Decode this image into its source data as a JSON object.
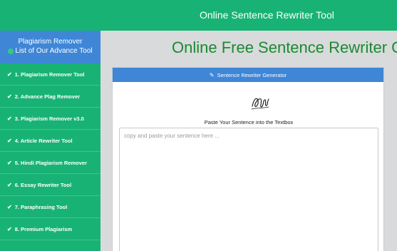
{
  "topbar": {
    "title": "Online Sentence Rewriter Tool"
  },
  "sidebar": {
    "header_line1": "Plagiarism Remover",
    "header_line2": "List of Our Advance Tool",
    "items": [
      {
        "label": "1. Plagiarism Remover Tool"
      },
      {
        "label": "2. Advance Plag Remover"
      },
      {
        "label": "3. Plagiarism Remover v3.0"
      },
      {
        "label": "4. Article Rewriter Tool"
      },
      {
        "label": "5. Hindi Plagiarism Remover"
      },
      {
        "label": "6. Essay Rewriter Tool"
      },
      {
        "label": "7. Paraphrasing Tool"
      },
      {
        "label": "8. Premium Plagiarism"
      }
    ]
  },
  "main": {
    "page_title": "Online Free Sentence Rewriter Gen",
    "panel_title": "Sentence Rewriter Generator",
    "instruction": "Paste Your Sentence into the Textbox",
    "textbox_placeholder": "copy and paste your sentence here ..."
  },
  "colors": {
    "brand_green": "#18b374",
    "accent_blue": "#3f86d6",
    "title_green": "#1a8a2f"
  },
  "icons": {
    "nav_check": "check-icon",
    "panel_pencil": "pencil-icon",
    "signature": "signature-icon"
  }
}
